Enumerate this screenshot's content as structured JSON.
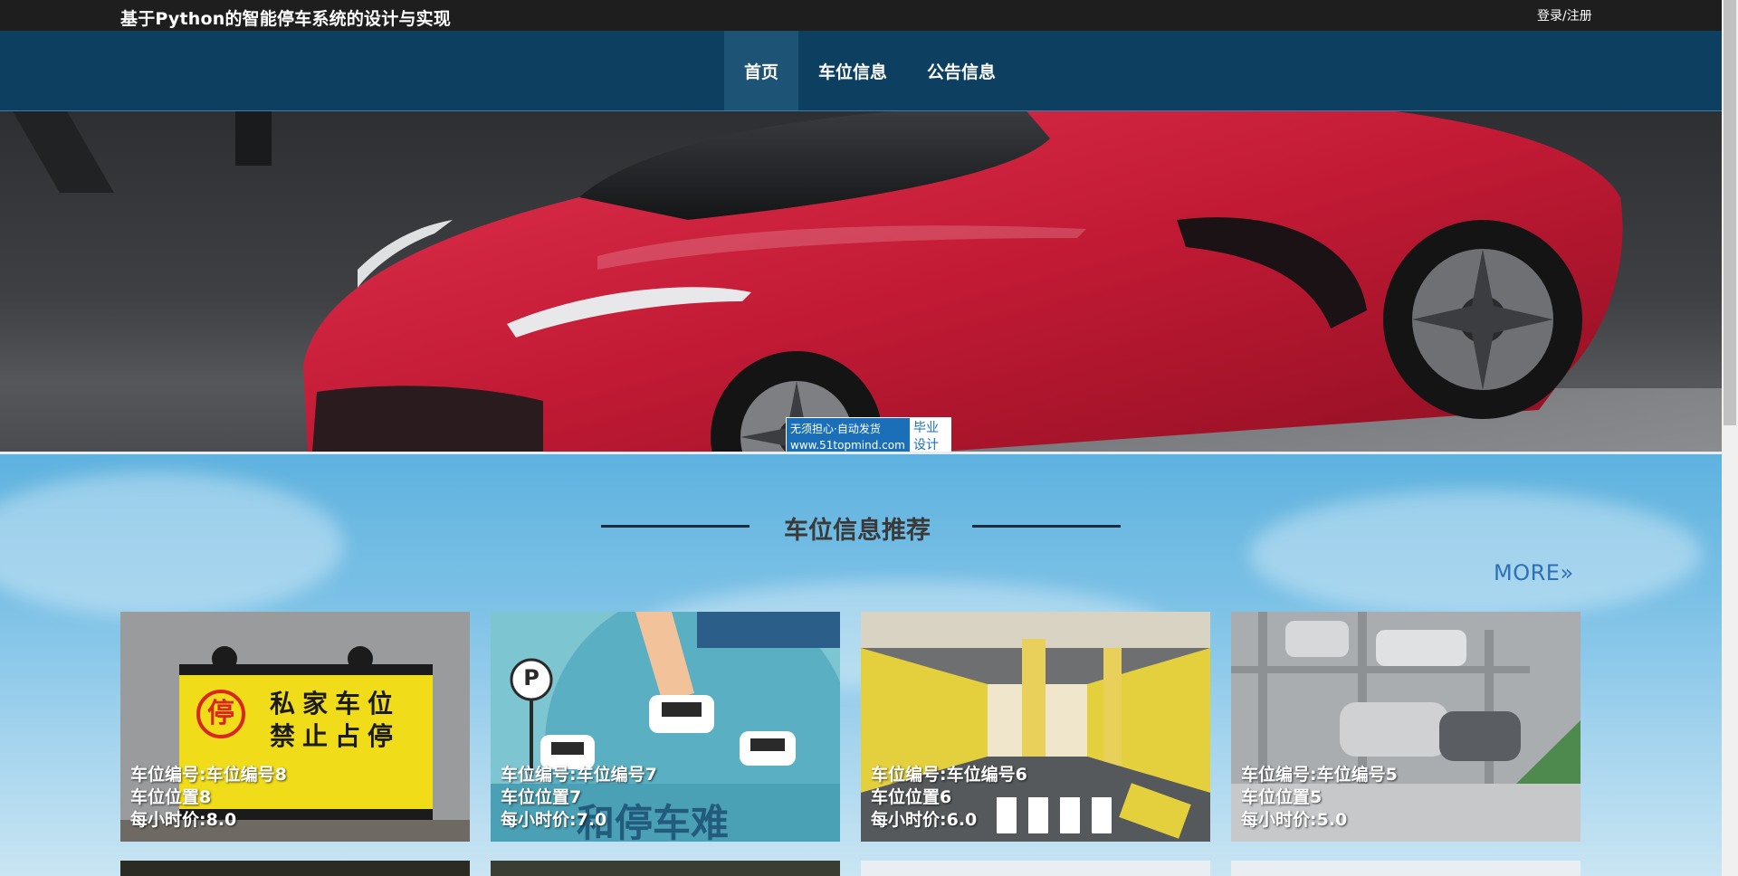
{
  "header": {
    "site_title": "基于Python的智能停车系统的设计与实现",
    "login_label": "登录/注册"
  },
  "nav": {
    "items": [
      {
        "label": "首页",
        "active": true
      },
      {
        "label": "车位信息",
        "active": false
      },
      {
        "label": "公告信息",
        "active": false
      }
    ]
  },
  "watermark": {
    "line1": "无须担心·自动发货",
    "line2": "www.51topmind.com",
    "right1": "毕业",
    "right2": "设计"
  },
  "section": {
    "title": "车位信息推荐",
    "more_label": "MORE»"
  },
  "cards": [
    {
      "line1": "车位编号:车位编号8",
      "line2": "车位位置8",
      "line3": "每小时价:8.0",
      "sign_text1": "私家车位",
      "sign_text2": "禁止占停",
      "sign_icon": "停"
    },
    {
      "line1": "车位编号:车位编号7",
      "line2": "车位位置7",
      "line3": "每小时价:7.0",
      "overlay_text": "和停车难",
      "parking_icon": "P"
    },
    {
      "line1": "车位编号:车位编号6",
      "line2": "车位位置6",
      "line3": "每小时价:6.0"
    },
    {
      "line1": "车位编号:车位编号5",
      "line2": "车位位置5",
      "line3": "每小时价:5.0"
    }
  ],
  "colors": {
    "topbar": "#1e1e1e",
    "navbar": "#0d3f60",
    "nav_active": "#1d5375",
    "more_link": "#2f6fb3"
  }
}
